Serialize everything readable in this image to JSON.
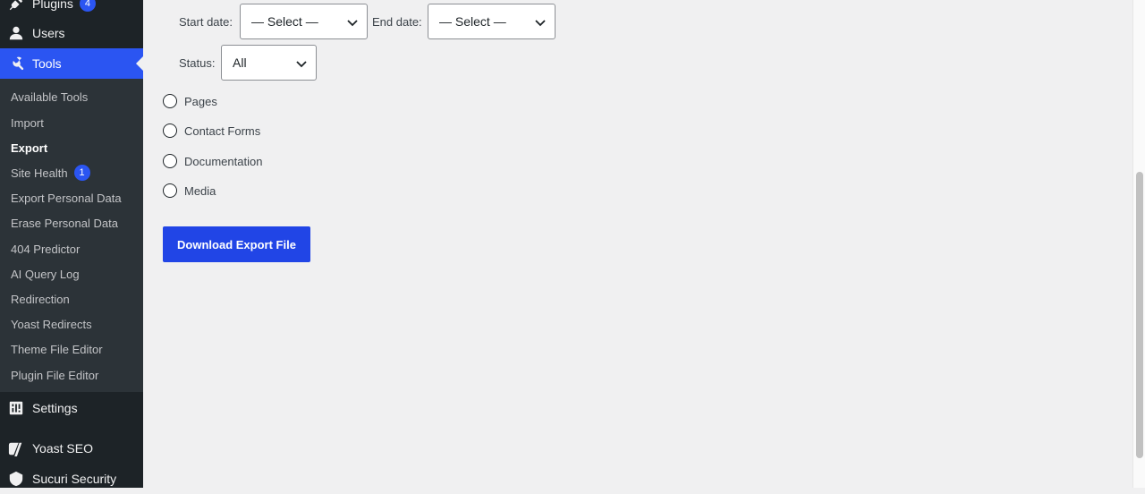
{
  "sidebar": {
    "plugins": {
      "label": "Plugins",
      "badge": "4",
      "icon": "plugin-icon"
    },
    "users": {
      "label": "Users",
      "icon": "user-icon"
    },
    "tools": {
      "label": "Tools",
      "icon": "wrench-icon"
    },
    "settings": {
      "label": "Settings",
      "icon": "settings-icon"
    },
    "yoast": {
      "label": "Yoast SEO",
      "icon": "yoast-icon"
    },
    "sucuri": {
      "label": "Sucuri Security",
      "icon": "sucuri-icon"
    },
    "submenu": [
      {
        "label": "Available Tools"
      },
      {
        "label": "Import"
      },
      {
        "label": "Export",
        "current": true
      },
      {
        "label": "Site Health",
        "badge": "1"
      },
      {
        "label": "Export Personal Data"
      },
      {
        "label": "Erase Personal Data"
      },
      {
        "label": "404 Predictor"
      },
      {
        "label": "AI Query Log"
      },
      {
        "label": "Redirection"
      },
      {
        "label": "Yoast Redirects"
      },
      {
        "label": "Theme File Editor"
      },
      {
        "label": "Plugin File Editor"
      }
    ]
  },
  "filters": {
    "start_date_label": "Start date:",
    "start_date_value": "— Select —",
    "end_date_label": "End date:",
    "end_date_value": "— Select —",
    "status_label": "Status:",
    "status_value": "All"
  },
  "export_options": [
    {
      "label": "Pages",
      "checked": false
    },
    {
      "label": "Contact Forms",
      "checked": false
    },
    {
      "label": "Documentation",
      "checked": false
    },
    {
      "label": "Media",
      "checked": false
    }
  ],
  "download_button": "Download Export File",
  "colors": {
    "accent": "#2b55f2",
    "button": "#2145e6",
    "sidebar_bg": "#1d2327",
    "submenu_bg": "#2c3338"
  }
}
